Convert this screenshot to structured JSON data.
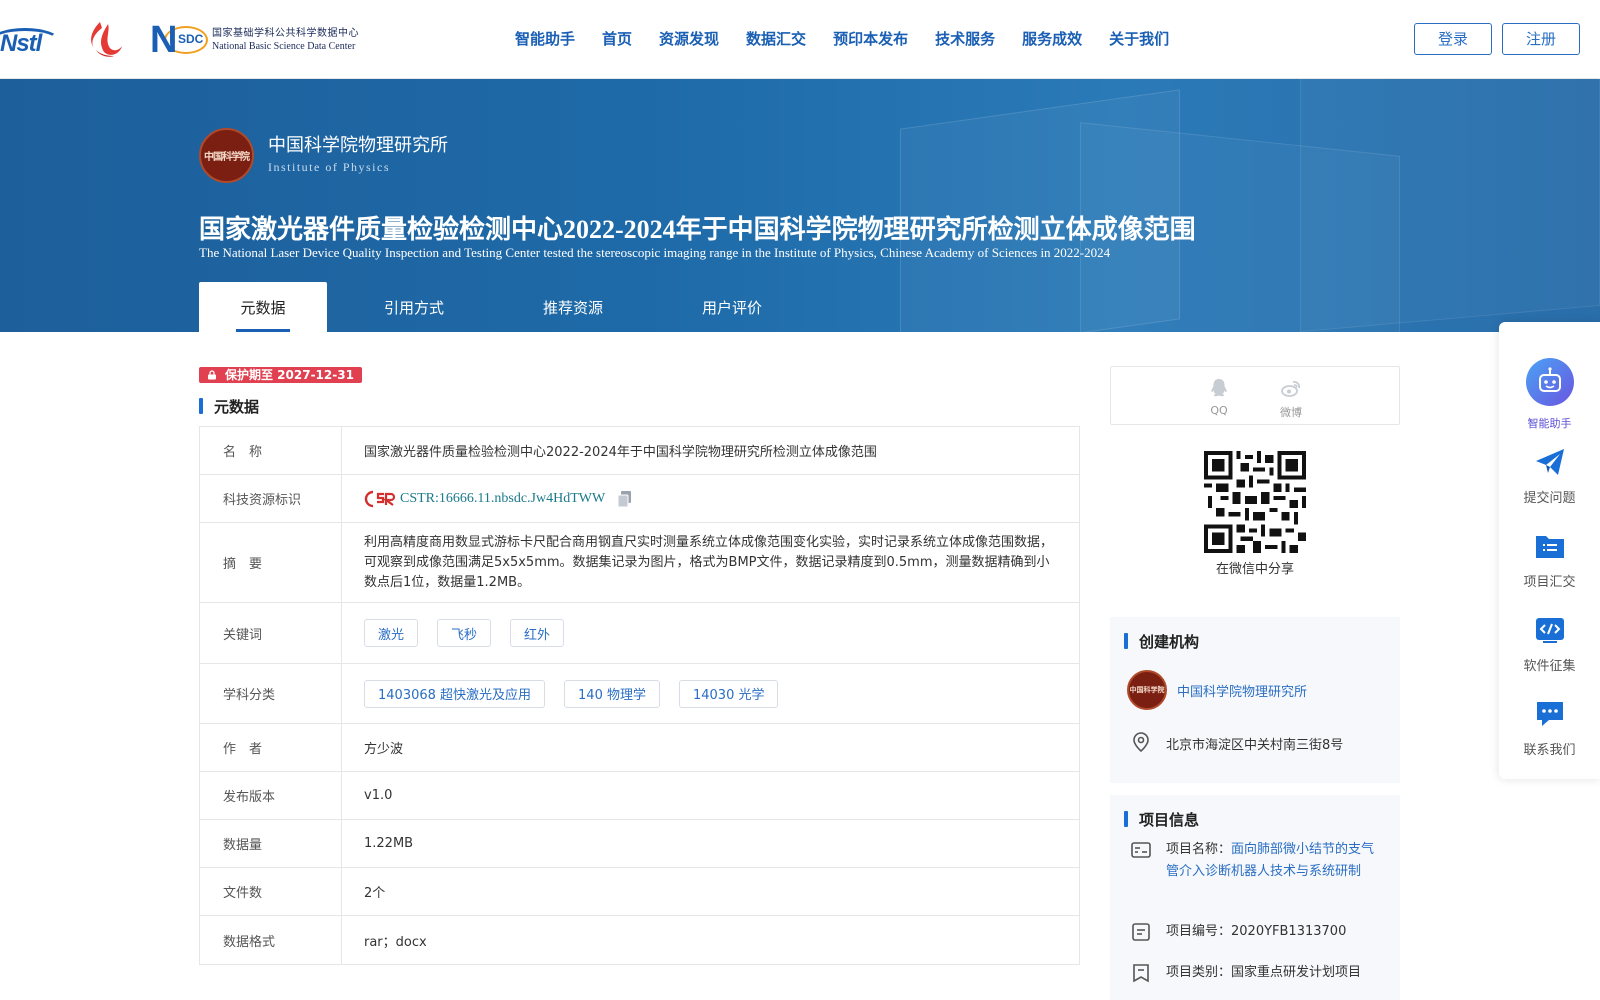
{
  "nav": {
    "logos": {
      "nstl": "Nstl",
      "nsdc_short": "N",
      "nsdc_mark": "SDC",
      "nsdc_cn": "国家基础学科公共科学数据中心",
      "nsdc_en": "National Basic Science Data Center"
    },
    "items": [
      "智能助手",
      "首页",
      "资源发现",
      "数据汇交",
      "预印本发布",
      "技术服务",
      "服务成效",
      "关于我们"
    ],
    "login": "登录",
    "register": "注册"
  },
  "institution": {
    "name": "中国科学院物理研究所",
    "name_en": "Institute of Physics",
    "logo_text": "中国科学院"
  },
  "page": {
    "title": "国家激光器件质量检验检测中心2022-2024年于中国科学院物理研究所检测立体成像范围",
    "subtitle": "The National Laser Device Quality Inspection and Testing Center tested the stereoscopic imaging range in the Institute of Physics, Chinese Academy of Sciences in 2022-2024"
  },
  "tabs": [
    "元数据",
    "引用方式",
    "推荐资源",
    "用户评价"
  ],
  "protection": "保护期至 2027-12-31",
  "metadata": {
    "heading": "元数据",
    "rows": {
      "name": {
        "key": "名　称",
        "value": "国家激光器件质量检验检测中心2022-2024年于中国科学院物理研究所检测立体成像范围"
      },
      "cstr": {
        "key": "科技资源标识",
        "value": "CSTR:16666.11.nbsdc.Jw4HdTWW"
      },
      "abstract": {
        "key": "摘　要",
        "value": "利用高精度商用数显式游标卡尺配合商用钢直尺实时测量系统立体成像范围变化实验，实时记录系统立体成像范围数据，可观察到成像范围满足5x5x5mm。数据集记录为图片，格式为BMP文件，数据记录精度到0.5mm，测量数据精确到小数点后1位，数据量1.2MB。"
      },
      "keywords": {
        "key": "关键词",
        "tags": [
          "激光",
          "飞秒",
          "红外"
        ]
      },
      "subjects": {
        "key": "学科分类",
        "tags": [
          "1403068 超快激光及应用",
          "140 物理学",
          "14030 光学"
        ]
      },
      "author": {
        "key": "作　者",
        "value": "方少波"
      },
      "version": {
        "key": "发布版本",
        "value": "v1.0"
      },
      "size": {
        "key": "数据量",
        "value": "1.22MB"
      },
      "files": {
        "key": "文件数",
        "value": "2个"
      },
      "format": {
        "key": "数据格式",
        "value": "rar；docx"
      }
    }
  },
  "share": {
    "qq": "QQ",
    "weibo": "微博",
    "wechat_caption": "在微信中分享"
  },
  "org": {
    "heading": "创建机构",
    "name": "中国科学院物理研究所",
    "address": "北京市海淀区中关村南三街8号",
    "logo_text": "中国科学院"
  },
  "project": {
    "heading": "项目信息",
    "name_label": "项目名称：",
    "name_value": "面向肺部微小结节的支气管介入诊断机器人技术与系统研制",
    "id_label": "项目编号：",
    "id_value": "2020YFB1313700",
    "type_label": "项目类别：",
    "type_value": "国家重点研发计划项目"
  },
  "float_panel": {
    "items": [
      "智能助手",
      "提交问题",
      "项目汇交",
      "软件征集",
      "联系我们"
    ]
  },
  "colors": {
    "brand_blue": "#1a5fb4",
    "banner": "#1e6aa8",
    "protect_red": "#e0404f",
    "link": "#2a6ec4",
    "cstr": "#1a7a8a"
  }
}
